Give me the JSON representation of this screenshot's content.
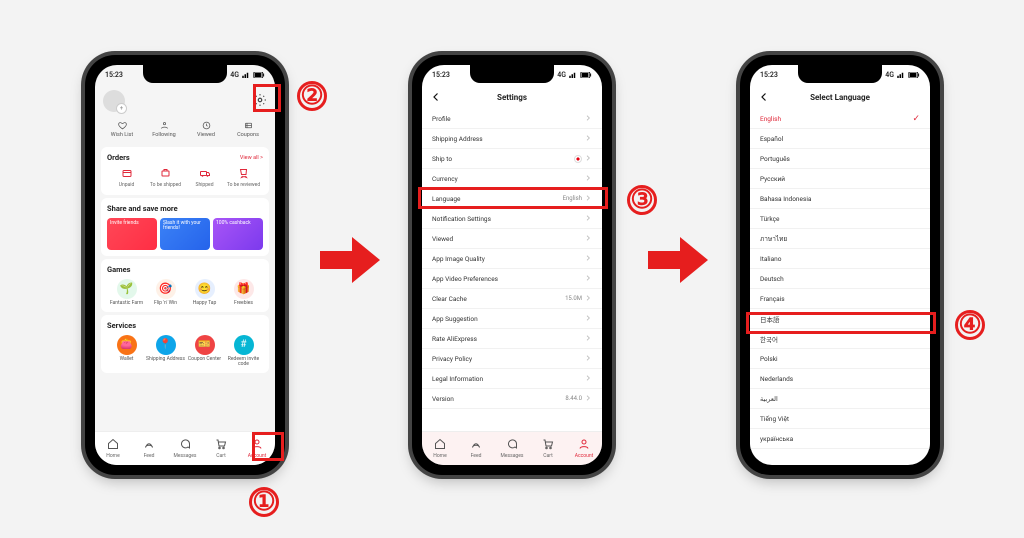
{
  "statusbar": {
    "time": "15:23",
    "net": "4G"
  },
  "p1": {
    "metrics": [
      {
        "label": "Wish List"
      },
      {
        "label": "Following"
      },
      {
        "label": "Viewed"
      },
      {
        "label": "Coupons"
      }
    ],
    "orders": {
      "title": "Orders",
      "viewall": "View all >",
      "items": [
        {
          "label": "Unpaid"
        },
        {
          "label": "To be shipped"
        },
        {
          "label": "Shipped"
        },
        {
          "label": "To be reviewed"
        }
      ]
    },
    "share": {
      "title": "Share and save more",
      "cards": [
        {
          "label": "Invite friends"
        },
        {
          "label": "Slash it with your friends!"
        },
        {
          "label": "100% cashback"
        }
      ]
    },
    "games": {
      "title": "Games",
      "items": [
        {
          "label": "Fantastic Farm"
        },
        {
          "label": "Flip 'n' Win"
        },
        {
          "label": "Happy Tap"
        },
        {
          "label": "Freebies"
        }
      ]
    },
    "services": {
      "title": "Services",
      "items": [
        {
          "label": "Wallet"
        },
        {
          "label": "Shipping Address"
        },
        {
          "label": "Coupon Center"
        },
        {
          "label": "Redeem invite code"
        }
      ]
    },
    "tabs": [
      {
        "label": "Home"
      },
      {
        "label": "Feed"
      },
      {
        "label": "Messages"
      },
      {
        "label": "Cart"
      },
      {
        "label": "Account"
      }
    ]
  },
  "p2": {
    "title": "Settings",
    "rows": [
      {
        "label": "Profile",
        "value": ""
      },
      {
        "label": "Shipping Address",
        "value": ""
      },
      {
        "label": "Ship to",
        "value": "",
        "flag": true
      },
      {
        "label": "Currency",
        "value": ""
      },
      {
        "label": "Language",
        "value": "English"
      },
      {
        "label": "Notification Settings",
        "value": ""
      },
      {
        "label": "Viewed",
        "value": ""
      },
      {
        "label": "App Image Quality",
        "value": ""
      },
      {
        "label": "App Video Preferences",
        "value": ""
      },
      {
        "label": "Clear Cache",
        "value": "15.0M"
      },
      {
        "label": "App Suggestion",
        "value": ""
      },
      {
        "label": "Rate AliExpress",
        "value": ""
      },
      {
        "label": "Privacy Policy",
        "value": ""
      },
      {
        "label": "Legal Information",
        "value": ""
      },
      {
        "label": "Version",
        "value": "8.44.0"
      }
    ]
  },
  "p3": {
    "title": "Select Language",
    "langs": [
      {
        "label": "English",
        "selected": true
      },
      {
        "label": "Español"
      },
      {
        "label": "Português"
      },
      {
        "label": "Русский"
      },
      {
        "label": "Bahasa Indonesia"
      },
      {
        "label": "Türkçe"
      },
      {
        "label": "ภาษาไทย"
      },
      {
        "label": "Italiano"
      },
      {
        "label": "Deutsch"
      },
      {
        "label": "Français"
      },
      {
        "label": "日本語"
      },
      {
        "label": "한국어"
      },
      {
        "label": "Polski"
      },
      {
        "label": "Nederlands"
      },
      {
        "label": "العربية"
      },
      {
        "label": "Tiếng Việt"
      },
      {
        "label": "українська"
      }
    ]
  },
  "callouts": {
    "1": "①",
    "2": "②",
    "3": "③",
    "4": "④"
  }
}
